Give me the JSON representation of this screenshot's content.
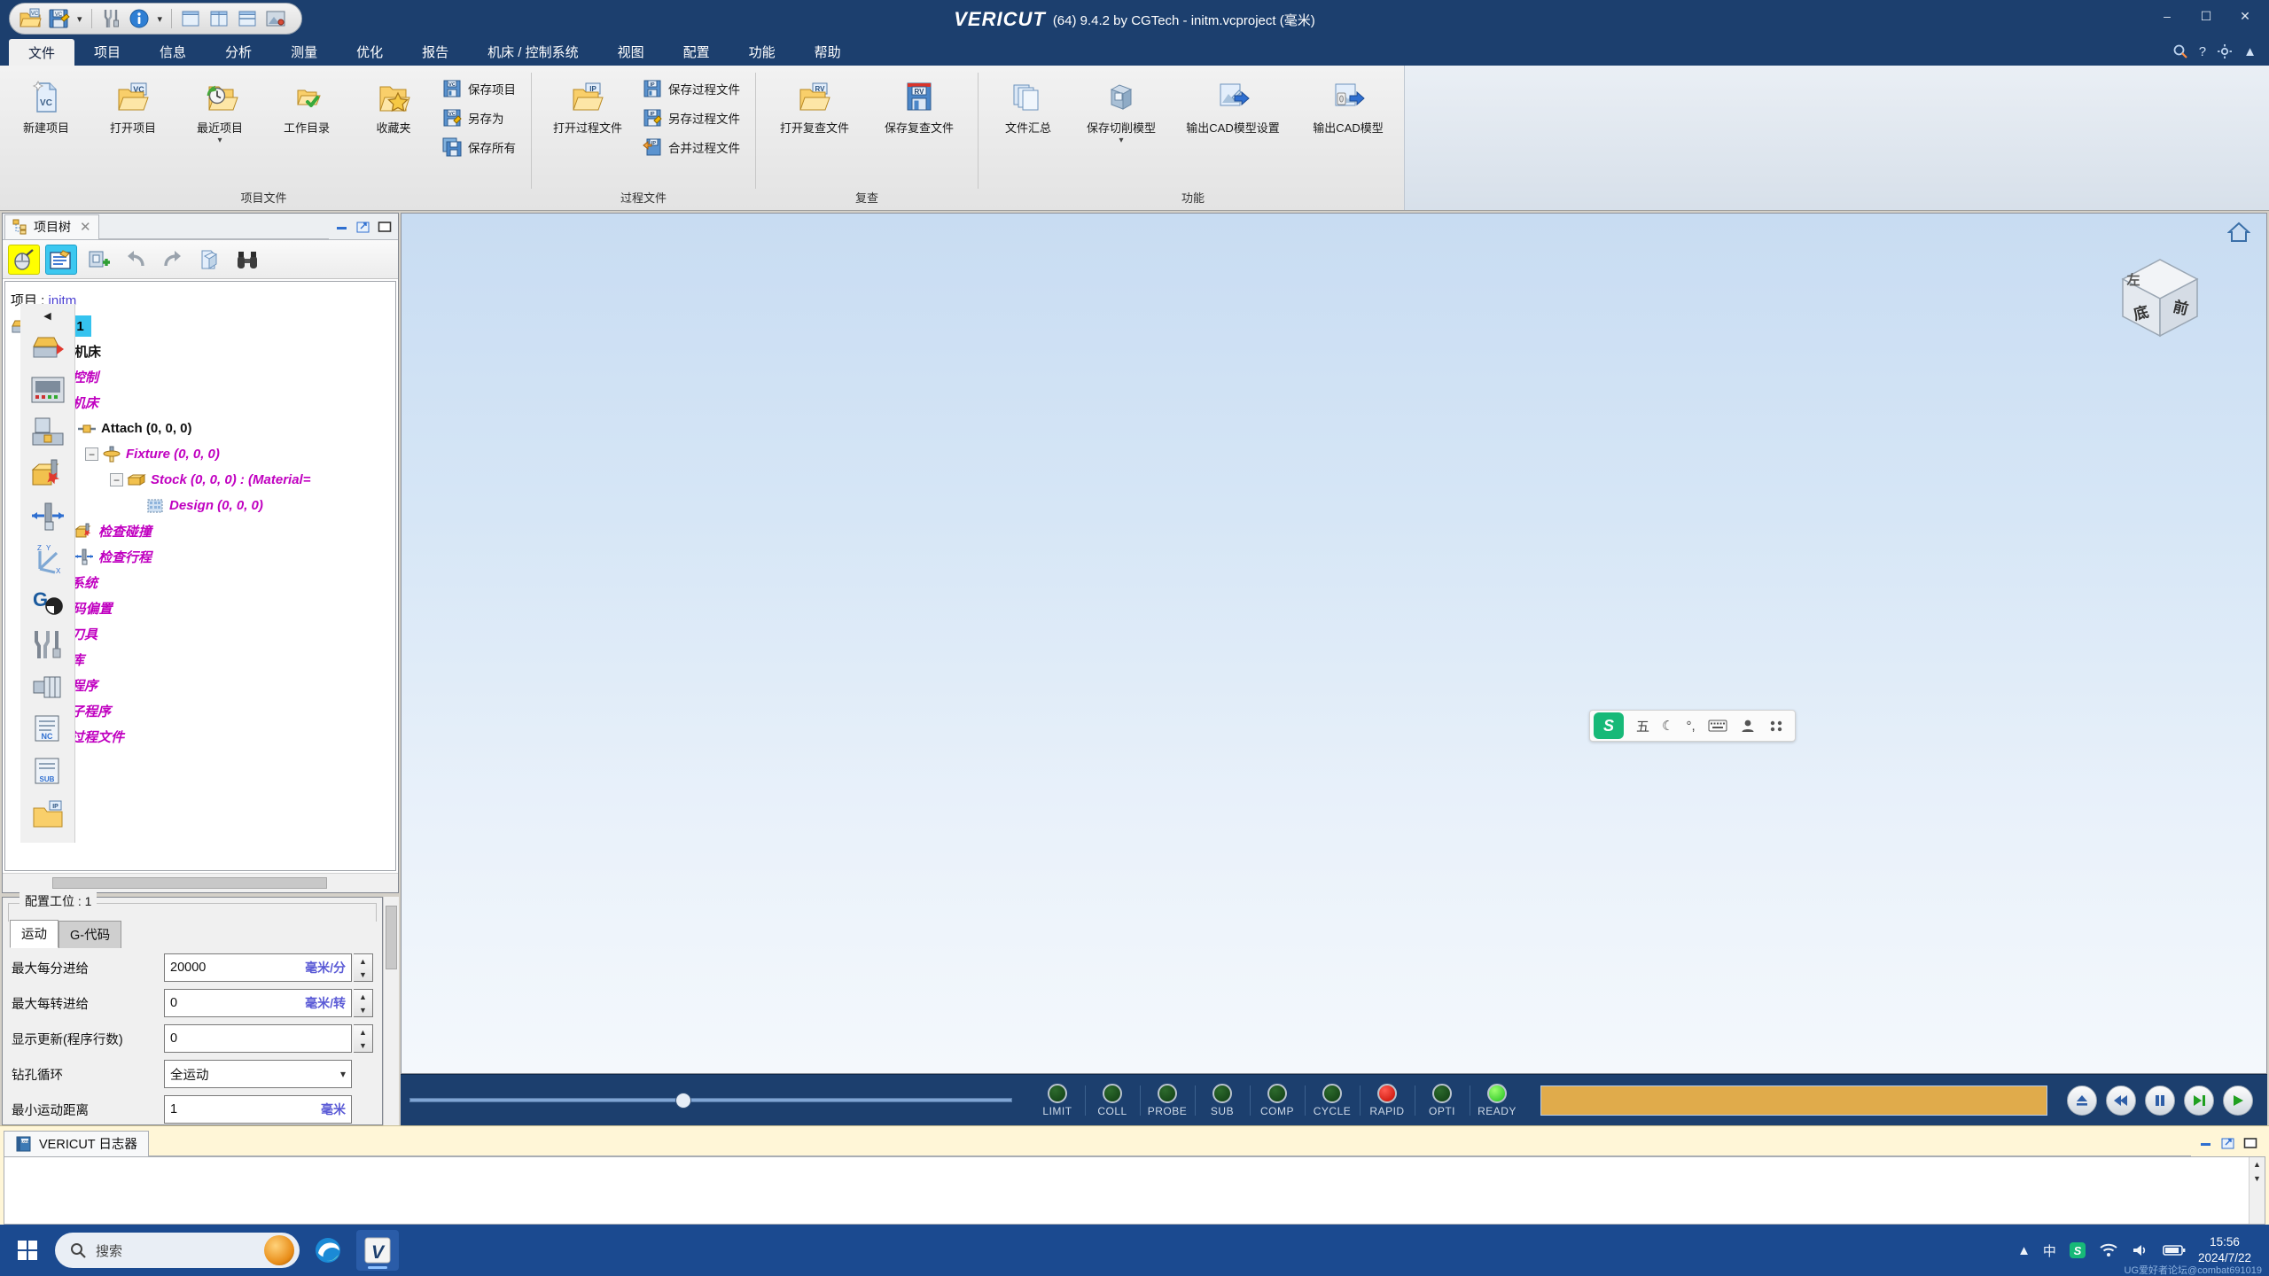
{
  "titlebar": {
    "brand": "VERICUT",
    "title_suffix": "(64) 9.4.2 by CGTech - initm.vcproject (毫米)",
    "quick_access": [
      {
        "name": "open-project-icon",
        "tip": "打开项目"
      },
      {
        "name": "save-project-icon",
        "tip": "保存项目"
      },
      {
        "name": "quick-dropdown-chevron",
        "tip": "下拉"
      },
      {
        "name": "tooling-icon",
        "tip": "刀具"
      },
      {
        "name": "info-icon",
        "tip": "信息"
      },
      {
        "name": "info-dropdown-chevron",
        "tip": "下拉"
      },
      {
        "name": "single-view-icon",
        "tip": "单视图"
      },
      {
        "name": "two-column-view-icon",
        "tip": "双列视图"
      },
      {
        "name": "two-row-view-icon",
        "tip": "双行视图"
      },
      {
        "name": "render-view-icon",
        "tip": "渲染视图"
      }
    ],
    "window_buttons": [
      "minimize",
      "maximize",
      "close"
    ]
  },
  "menubar": {
    "items": [
      {
        "label": "文件",
        "active": true
      },
      {
        "label": "项目",
        "active": false
      },
      {
        "label": "信息",
        "active": false
      },
      {
        "label": "分析",
        "active": false
      },
      {
        "label": "测量",
        "active": false
      },
      {
        "label": "优化",
        "active": false
      },
      {
        "label": "报告",
        "active": false
      },
      {
        "label": "机床 / 控制系统",
        "active": false
      },
      {
        "label": "视图",
        "active": false
      },
      {
        "label": "配置",
        "active": false
      },
      {
        "label": "功能",
        "active": false
      },
      {
        "label": "帮助",
        "active": false
      }
    ],
    "right_icons": [
      "search-icon",
      "help-icon",
      "settings-icon",
      "collapse-ribbon-icon"
    ]
  },
  "ribbon": {
    "groups": [
      {
        "title": "项目文件",
        "large_buttons": [
          {
            "label": "新建项目",
            "icon": "new-project-icon",
            "has_dropdown": false
          },
          {
            "label": "打开项目",
            "icon": "open-project-folder-icon",
            "has_dropdown": false
          },
          {
            "label": "最近项目",
            "icon": "recent-projects-icon",
            "has_dropdown": true
          },
          {
            "label": "工作目录",
            "icon": "working-directory-icon",
            "has_dropdown": false
          },
          {
            "label": "收藏夹",
            "icon": "favorites-icon",
            "has_dropdown": false
          }
        ],
        "small_buttons": [
          {
            "label": "保存项目",
            "icon": "save-project-icon"
          },
          {
            "label": "另存为",
            "icon": "save-as-icon"
          },
          {
            "label": "保存所有",
            "icon": "save-all-icon"
          }
        ]
      },
      {
        "title": "过程文件",
        "large_buttons": [
          {
            "label": "打开过程文件",
            "icon": "open-process-file-icon",
            "has_dropdown": false
          }
        ],
        "small_buttons": [
          {
            "label": "保存过程文件",
            "icon": "save-process-file-icon"
          },
          {
            "label": "另存过程文件",
            "icon": "save-process-file-as-icon"
          },
          {
            "label": "合并过程文件",
            "icon": "merge-process-file-icon"
          }
        ]
      },
      {
        "title": "复查",
        "large_buttons": [
          {
            "label": "打开复查文件",
            "icon": "open-review-file-icon",
            "has_dropdown": false
          },
          {
            "label": "保存复查文件",
            "icon": "save-review-file-icon",
            "has_dropdown": false
          }
        ],
        "small_buttons": []
      },
      {
        "title": "功能",
        "large_buttons": [
          {
            "label": "文件汇总",
            "icon": "file-summary-icon",
            "has_dropdown": false
          },
          {
            "label": "保存切削模型",
            "icon": "save-cut-model-icon",
            "has_dropdown": true
          },
          {
            "label": "输出CAD模型设置",
            "icon": "export-cad-settings-icon",
            "has_dropdown": false
          },
          {
            "label": "输出CAD模型",
            "icon": "export-cad-model-icon",
            "has_dropdown": false
          }
        ],
        "small_buttons": []
      }
    ]
  },
  "project_panel": {
    "tab_label": "项目树",
    "tab_close": "✕",
    "window_buttons": [
      "minimize",
      "restore",
      "maximize"
    ],
    "toolbar": [
      {
        "name": "mouse-config-icon",
        "highlight": "yellow"
      },
      {
        "name": "tree-config-icon",
        "highlight": "blue"
      },
      {
        "name": "add-component-icon",
        "highlight": "none"
      },
      {
        "name": "undo-icon",
        "highlight": "none"
      },
      {
        "name": "redo-icon",
        "highlight": "none"
      },
      {
        "name": "model-export-icon",
        "highlight": "none"
      },
      {
        "name": "search-binoculars-icon",
        "highlight": "none"
      }
    ],
    "rail_buttons": [
      {
        "name": "collapse-rail-icon"
      },
      {
        "name": "setup-icon"
      },
      {
        "name": "control-icon"
      },
      {
        "name": "machine-icon"
      },
      {
        "name": "collision-check-icon"
      },
      {
        "name": "travel-limits-icon"
      },
      {
        "name": "coordinate-system-icon"
      },
      {
        "name": "gcode-offsets-icon"
      },
      {
        "name": "tooling-icon"
      },
      {
        "name": "assembly-library-icon"
      },
      {
        "name": "nc-program-icon"
      },
      {
        "name": "nc-subroutine-icon"
      },
      {
        "name": "save-process-file-icon"
      }
    ],
    "tree": [
      {
        "id": "project",
        "label_prefix": "项目 : ",
        "label": "initm",
        "style": "project",
        "indent": 0,
        "icon": "none",
        "expander": "none"
      },
      {
        "id": "setup",
        "label": "工位 : 1",
        "style": "selected",
        "indent": 0,
        "icon": "setup-icon",
        "expander": "none"
      },
      {
        "id": "nc-machine",
        "label": "数控机床",
        "style": "black",
        "indent": 1,
        "icon": "none",
        "expander": "none"
      },
      {
        "id": "control",
        "label": "控制",
        "style": "magenta",
        "indent": 2,
        "icon": "control-icon",
        "expander": "none"
      },
      {
        "id": "machine",
        "label": "机床",
        "style": "magenta",
        "indent": 2,
        "icon": "machine-icon",
        "expander": "none"
      },
      {
        "id": "attach",
        "label": "Attach (0, 0, 0)",
        "style": "black",
        "indent": 3,
        "icon": "attach-icon",
        "expander": "minus"
      },
      {
        "id": "fixture",
        "label": "Fixture (0, 0, 0)",
        "style": "magenta",
        "indent": 4,
        "icon": "fixture-icon",
        "expander": "minus"
      },
      {
        "id": "stock",
        "label": "Stock (0, 0, 0) : (Material=",
        "style": "magenta",
        "indent": 5,
        "icon": "stock-icon",
        "expander": "minus"
      },
      {
        "id": "design",
        "label": "Design (0, 0, 0)",
        "style": "magenta",
        "indent": 6,
        "icon": "design-icon",
        "expander": "none"
      },
      {
        "id": "collision",
        "label": "检查碰撞",
        "style": "magenta",
        "indent": 3,
        "icon": "collision-check-icon",
        "expander": "none"
      },
      {
        "id": "travel",
        "label": "检查行程",
        "style": "magenta",
        "indent": 3,
        "icon": "travel-limits-icon",
        "expander": "none"
      },
      {
        "id": "coordsys",
        "label": "坐标系统",
        "style": "magenta",
        "indent": 0,
        "icon": "none",
        "expander": "none"
      },
      {
        "id": "gcode-offset",
        "label": "G-代码偏置",
        "style": "magenta",
        "indent": 0,
        "icon": "none",
        "expander": "none"
      },
      {
        "id": "tooling",
        "label": "加工刀具",
        "style": "magenta",
        "indent": 0,
        "icon": "none",
        "expander": "none"
      },
      {
        "id": "assembly",
        "label": "装配库",
        "style": "magenta",
        "indent": 0,
        "icon": "none",
        "expander": "none"
      },
      {
        "id": "nc-program",
        "label": "数控程序",
        "style": "magenta",
        "indent": 0,
        "icon": "none",
        "expander": "none"
      },
      {
        "id": "nc-sub",
        "label": "数控子程序",
        "style": "magenta",
        "indent": 0,
        "icon": "none",
        "expander": "none"
      },
      {
        "id": "save-process",
        "label": "保存过程文件",
        "style": "magenta",
        "indent": 0,
        "icon": "none",
        "expander": "none"
      }
    ]
  },
  "config_panel": {
    "legend": "配置工位 : 1",
    "tabs": [
      {
        "label": "运动",
        "selected": true
      },
      {
        "label": "G-代码",
        "selected": false
      }
    ],
    "rows": [
      {
        "key": "最大每分进给",
        "value": "20000",
        "unit": "毫米/分",
        "type": "spin"
      },
      {
        "key": "最大每转进给",
        "value": "0",
        "unit": "毫米/转",
        "type": "spin"
      },
      {
        "key": "显示更新(程序行数)",
        "value": "0",
        "unit": "",
        "type": "spin"
      },
      {
        "key": "钻孔循环",
        "value": "全运动",
        "unit": "",
        "type": "select"
      },
      {
        "key": "最小运动距离",
        "value": "1",
        "unit": "毫米",
        "type": "plain"
      }
    ]
  },
  "viewport": {
    "home_icon": "home-icon",
    "viewcube": {
      "faces": [
        "前",
        "底",
        "左"
      ]
    },
    "ime_bar": {
      "logo": "S",
      "items": [
        "五",
        "moon-icon",
        "punctuation-icon",
        "keyboard-icon",
        "user-icon",
        "apps-icon"
      ]
    }
  },
  "statusbar": {
    "slider_value": 32,
    "leds": [
      {
        "label": "LIMIT",
        "state": "off"
      },
      {
        "label": "COLL",
        "state": "off"
      },
      {
        "label": "PROBE",
        "state": "off"
      },
      {
        "label": "SUB",
        "state": "off"
      },
      {
        "label": "COMP",
        "state": "off"
      },
      {
        "label": "CYCLE",
        "state": "off"
      },
      {
        "label": "RAPID",
        "state": "red"
      },
      {
        "label": "OPTI",
        "state": "off"
      },
      {
        "label": "READY",
        "state": "green"
      }
    ],
    "progress_color": "#e0ab4b",
    "progress_value": 100,
    "controls": [
      {
        "name": "reset-button",
        "glyph": "eject"
      },
      {
        "name": "rewind-button",
        "glyph": "rewind"
      },
      {
        "name": "pause-button",
        "glyph": "pause"
      },
      {
        "name": "single-step-button",
        "glyph": "step"
      },
      {
        "name": "play-button",
        "glyph": "play"
      }
    ]
  },
  "log_panel": {
    "tab_label": "VERICUT 日志器",
    "tab_icon": "log-book-icon",
    "window_buttons": [
      "minimize",
      "restore",
      "maximize"
    ]
  },
  "taskbar": {
    "start_icon": "windows-start-icon",
    "search_placeholder": "搜索",
    "apps": [
      {
        "name": "taskbar-edge",
        "label": "Edge",
        "active": false
      },
      {
        "name": "taskbar-vericut",
        "label": "V",
        "active": true
      }
    ],
    "tray_icons": [
      "chevron-up-icon",
      "ime-mode-icon",
      "sogou-icon",
      "wifi-icon",
      "volume-icon",
      "battery-icon"
    ],
    "clock_time": "15:56",
    "clock_date": "2024/7/22",
    "watermark": "UG爱好者论坛@combat691019"
  }
}
